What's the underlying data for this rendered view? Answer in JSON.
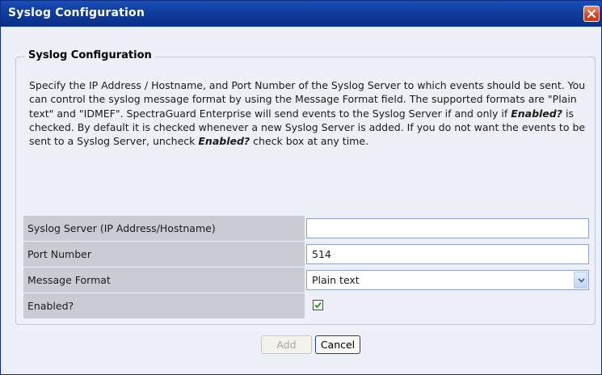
{
  "window": {
    "title": "Syslog Configuration"
  },
  "section": {
    "legend": "Syslog Configuration"
  },
  "description": {
    "p1": "Specify the IP Address / Hostname, and Port Number of the Syslog Server to which events should be sent. You can control the syslog message format by using the Message Format field. The supported formats are \"Plain text\" and \"IDMEF\". SpectraGuard Enterprise will send events to the Syslog Server if and only if ",
    "em1": "Enabled?",
    "p2": " is checked. By default it is checked whenever a new Syslog Server is added. If you do not want the events to be sent to a Syslog Server, uncheck ",
    "em2": "Enabled?",
    "p3": " check box at any time."
  },
  "form": {
    "server_label": "Syslog Server (IP Address/Hostname)",
    "server_value": "",
    "port_label": "Port Number",
    "port_value": "514",
    "format_label": "Message Format",
    "format_value": "Plain text",
    "enabled_label": "Enabled?",
    "enabled_checked": true
  },
  "buttons": {
    "add": "Add",
    "cancel": "Cancel"
  },
  "colors": {
    "titlebar": "#0f3c9f",
    "close": "#d9461f",
    "label_bg": "#c9ccd3",
    "check": "#21a121"
  },
  "icons": {
    "close": "close-icon",
    "dropdown": "chevron-down-icon",
    "check": "checkmark-icon"
  }
}
